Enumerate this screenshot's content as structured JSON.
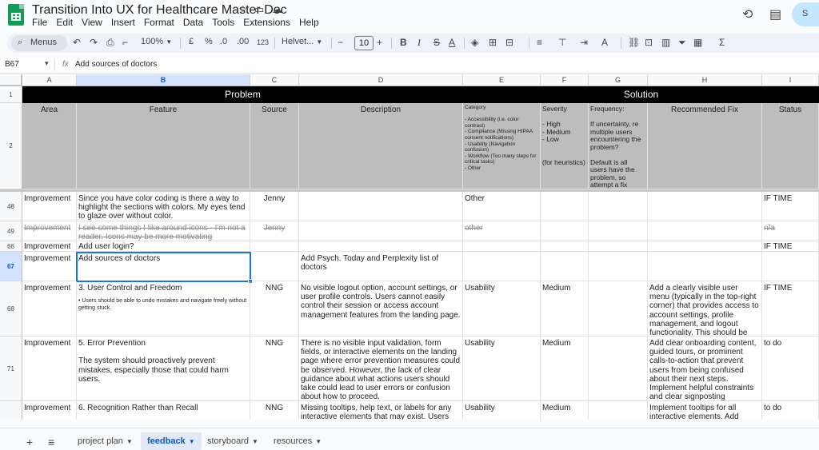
{
  "app": {
    "title": "Transition Into UX for Healthcare Master Doc",
    "menu": [
      "File",
      "Edit",
      "View",
      "Insert",
      "Format",
      "Data",
      "Tools",
      "Extensions",
      "Help"
    ],
    "share_label": "S"
  },
  "toolbar": {
    "menus_label": "Menus",
    "zoom": "100%",
    "currency": "£",
    "percent": "%",
    "decimal_dec": ".0",
    "decimal_inc": ".00",
    "number_format": "123",
    "font": "Helvet...",
    "font_size": "10"
  },
  "formula_bar": {
    "cell_ref": "B67",
    "value": "Add sources of doctors"
  },
  "columns": [
    "A",
    "B",
    "C",
    "D",
    "E",
    "F",
    "G",
    "H",
    "I"
  ],
  "selected_column": "B",
  "header_band": {
    "problem": "Problem",
    "solution": "Solution"
  },
  "header_row": {
    "row_num": "2",
    "area": "Area",
    "feature": "Feature",
    "source": "Source",
    "description": "Description",
    "category": "Category\n\n- Accessibility (i.e. color contrast)\n- Compliance (Missing HIPAA consent notifications)\n- Usability (Navigation confusion)\n- Workflow (Too many steps for critical tasks)\n- Other",
    "severity": "Severity\n\n- High\n- Medium\n- Low\n\n\n(for heuristics)",
    "frequency": "Frequency:\n\nIf uncertainty, re multiple users encountering the problem?\n\nDefault is all users have the problem, so attempt a fix",
    "recommended_fix": "Recommended Fix",
    "status": "Status"
  },
  "row1_num": "1",
  "rows": [
    {
      "num": "48",
      "area": "Improvement",
      "feature": "Since you have color coding is there a way to highlight the sections with colors. My eyes tend to glaze over without color.",
      "source": "Jenny",
      "description": "",
      "category": "Other",
      "severity": "",
      "frequency": "",
      "fix": "",
      "status": "IF TIME"
    },
    {
      "num": "49",
      "area": "Improvement",
      "feature": "I see some things I like around icons - I'm not a reader. Icons may be more motivating",
      "source": "Jenny",
      "description": "",
      "category": "other",
      "severity": "",
      "frequency": "",
      "fix": "",
      "status": "n/a"
    },
    {
      "num": "66",
      "area": "Improvement",
      "feature": "Add user login?",
      "source": "",
      "description": "",
      "category": "",
      "severity": "",
      "frequency": "",
      "fix": "",
      "status": "IF TIME"
    },
    {
      "num": "67",
      "area": "Improvement",
      "feature": "Add sources of doctors",
      "source": "",
      "description": "Add Psych. Today and Perplexity list of doctors\n\nAdd professional associations",
      "category": "",
      "severity": "",
      "frequency": "",
      "fix": "",
      "status": ""
    },
    {
      "num": "68",
      "area": "Improvement",
      "feature": "3. User Control and Freedom",
      "feature_note": "• Users should be able to undo mistakes and navigate freely without getting stuck.",
      "source": "NNG",
      "description": "No visible logout option, account settings, or user profile controls. Users cannot easily control their session or access account management features from the landing page.",
      "category": "Usability",
      "severity": "Medium",
      "frequency": "",
      "fix": "Add a clearly visible user menu (typically in the top-right corner) that provides access to account settings, profile management, and logout functionality. This should be accessible from all pages.",
      "status": "IF TIME"
    },
    {
      "num": "71",
      "area": "Improvement",
      "feature": "5. Error Prevention\n\nThe system should proactively prevent mistakes, especially those that could harm users.",
      "source": "NNG",
      "description": "There is no visible input validation, form fields, or interactive elements on the landing page where error prevention measures could be observed. However, the lack of clear guidance about what actions users should take could lead to user errors or confusion about how to proceed.",
      "category": "Usability",
      "severity": "Medium",
      "frequency": "",
      "fix": "Add clear onboarding content, guided tours, or prominent calls-to-action that prevent users from being confused about their next steps. Implement helpful constraints and clear signposting throughout the user journey.",
      "status": "to do"
    },
    {
      "num": "",
      "area": "Improvement",
      "feature": "6. Recognition Rather than Recall",
      "source": "NNG",
      "description": "Missing tooltips, help text, or labels for any interactive elements that may exist. Users cannot",
      "category": "Usability",
      "severity": "Medium",
      "frequency": "",
      "fix": "Implement tooltips for all interactive elements. Add",
      "status": "to do"
    }
  ],
  "sheets": [
    {
      "label": "project plan",
      "active": false
    },
    {
      "label": "feedback",
      "active": true
    },
    {
      "label": "storyboard",
      "active": false
    },
    {
      "label": "resources",
      "active": false
    }
  ]
}
